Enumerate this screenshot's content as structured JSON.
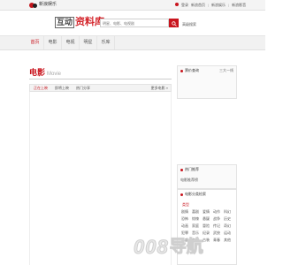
{
  "topbar": {
    "brand_text": "新浪娱乐",
    "links": [
      "登录",
      "新浪首页",
      "新浪娱乐",
      "新浪影音"
    ]
  },
  "header": {
    "logo_box": "互动",
    "logo_rest": "资料库",
    "search_placeholder": "明星、电影、电视剧",
    "search_extra": "高级搜索"
  },
  "nav": {
    "items": [
      "首页",
      "电影",
      "电视",
      "明星",
      "乐库"
    ],
    "active_index": 0
  },
  "main": {
    "title": "电影",
    "title_en": "Movie",
    "tabs": [
      "正在上映",
      "即将上映",
      "热门分享"
    ],
    "active_tab": 0,
    "tabs_right": "更多电影 »"
  },
  "sidebar": {
    "box1_title": "票价查询",
    "box1_link": "三大一线",
    "box2_title": "热门推荐",
    "box2_line": "电影推荐榜",
    "box3_title": "电影分类检索",
    "genre_title": "类型",
    "genres": [
      "剧情",
      "喜剧",
      "爱情",
      "动作",
      "科幻",
      "恐怖",
      "惊悚",
      "悬疑",
      "战争",
      "历史",
      "动画",
      "家庭",
      "冒险",
      "传记",
      "奇幻",
      "犯罪",
      "音乐",
      "纪录",
      "武侠",
      "运动",
      "西部",
      "灾难",
      "古装",
      "青春",
      "其他"
    ]
  },
  "watermark": {
    "digits": "008",
    "cn": "导航"
  },
  "colors": {
    "accent": "#c9151e",
    "nav_bg": "#f1f1f1"
  }
}
